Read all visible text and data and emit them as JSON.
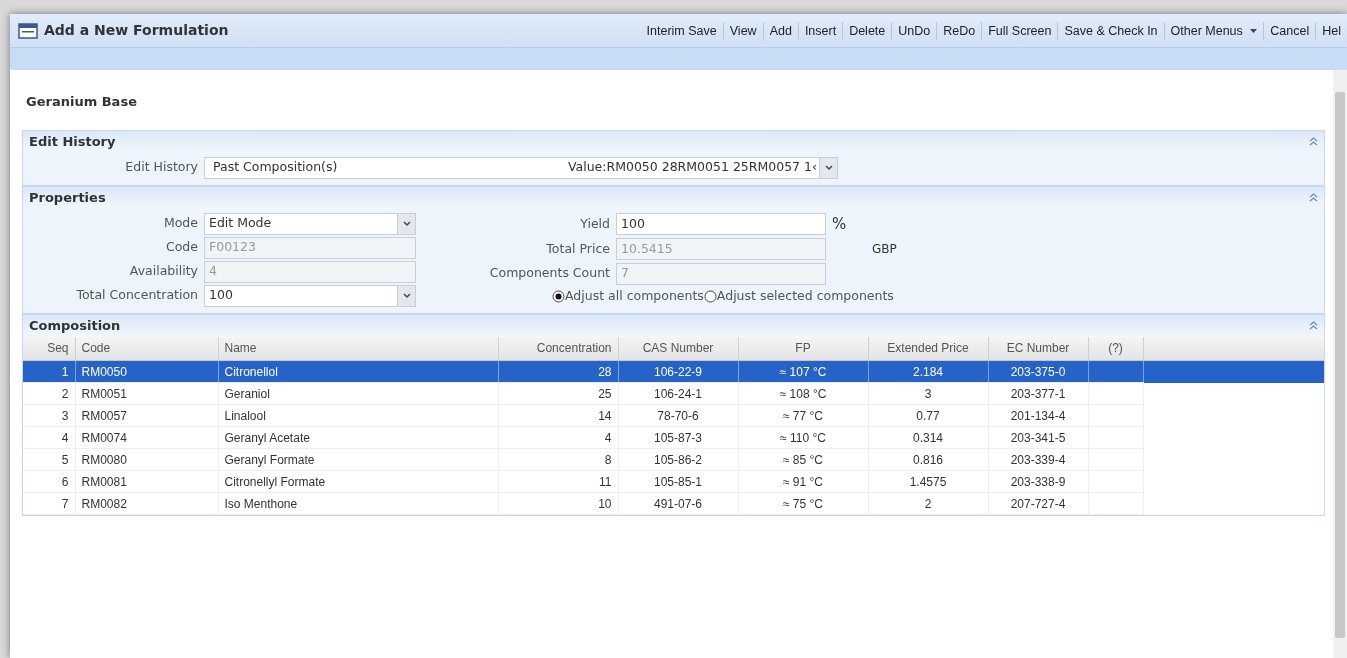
{
  "window": {
    "title": "Add a New Formulation"
  },
  "toolbar": [
    {
      "label": "Interim Save",
      "has_menu": false
    },
    {
      "label": "View",
      "has_menu": false
    },
    {
      "label": "Add",
      "has_menu": false
    },
    {
      "label": "Insert",
      "has_menu": false
    },
    {
      "label": "Delete",
      "has_menu": false
    },
    {
      "label": "UnDo",
      "has_menu": false
    },
    {
      "label": "ReDo",
      "has_menu": false
    },
    {
      "label": "Full Screen",
      "has_menu": false
    },
    {
      "label": "Save & Check In",
      "has_menu": false
    },
    {
      "label": "Other Menus",
      "has_menu": true
    },
    {
      "label": "Cancel",
      "has_menu": false
    },
    {
      "label": "Hel",
      "has_menu": false
    }
  ],
  "record_title": "Geranium Base",
  "edit_history": {
    "title": "Edit History",
    "label": "Edit History",
    "value": "Past Composition(s)",
    "detail": "Value:RM0050 28RM0051 25RM0057 1‹"
  },
  "properties": {
    "title": "Properties",
    "left_fields": [
      {
        "label": "Mode",
        "value": "Edit Mode",
        "kind": "select",
        "disabled": false
      },
      {
        "label": "Code",
        "value": "F00123",
        "kind": "text",
        "disabled": true
      },
      {
        "label": "Availability",
        "value": "4",
        "kind": "text",
        "disabled": true
      },
      {
        "label": "Total Concentration",
        "value": "100",
        "kind": "select",
        "disabled": false
      }
    ],
    "right_fields": [
      {
        "label": "Yield",
        "value": "100",
        "disabled": false,
        "suffix": "%"
      },
      {
        "label": "Total Price",
        "value": "10.5415",
        "disabled": true,
        "suffix": "GBP"
      },
      {
        "label": "Components Count",
        "value": "7",
        "disabled": true
      }
    ],
    "adjust_options": [
      {
        "label": "Adjust all components",
        "selected": true
      },
      {
        "label": "Adjust selected components",
        "selected": false
      }
    ]
  },
  "composition": {
    "title": "Composition",
    "columns": [
      "Seq",
      "Code",
      "Name",
      "Concentration",
      "CAS Number",
      "FP",
      "Extended Price",
      "EC Number",
      "(?)"
    ],
    "rows": [
      {
        "selected": true,
        "cells": [
          "1",
          "RM0050",
          "Citronellol",
          "28",
          "106-22-9",
          "≈ 107 °C",
          "2.184",
          "203-375-0",
          ""
        ]
      },
      {
        "selected": false,
        "cells": [
          "2",
          "RM0051",
          "Geraniol",
          "25",
          "106-24-1",
          "≈ 108 °C",
          "3",
          "203-377-1",
          ""
        ]
      },
      {
        "selected": false,
        "cells": [
          "3",
          "RM0057",
          "Linalool",
          "14",
          "78-70-6",
          "≈ 77 °C",
          "0.77",
          "201-134-4",
          ""
        ]
      },
      {
        "selected": false,
        "cells": [
          "4",
          "RM0074",
          "Geranyl Acetate",
          "4",
          "105-87-3",
          "≈ 110 °C",
          "0.314",
          "203-341-5",
          ""
        ]
      },
      {
        "selected": false,
        "cells": [
          "5",
          "RM0080",
          "Geranyl Formate",
          "8",
          "105-86-2",
          "≈ 85 °C",
          "0.816",
          "203-339-4",
          ""
        ]
      },
      {
        "selected": false,
        "cells": [
          "6",
          "RM0081",
          "Citronellyl Formate",
          "11",
          "105-85-1",
          "≈ 91 °C",
          "1.4575",
          "203-338-9",
          ""
        ]
      },
      {
        "selected": false,
        "cells": [
          "7",
          "RM0082",
          "Iso Menthone",
          "10",
          "491-07-6",
          "≈ 75 °C",
          "2",
          "207-727-4",
          ""
        ]
      }
    ]
  }
}
